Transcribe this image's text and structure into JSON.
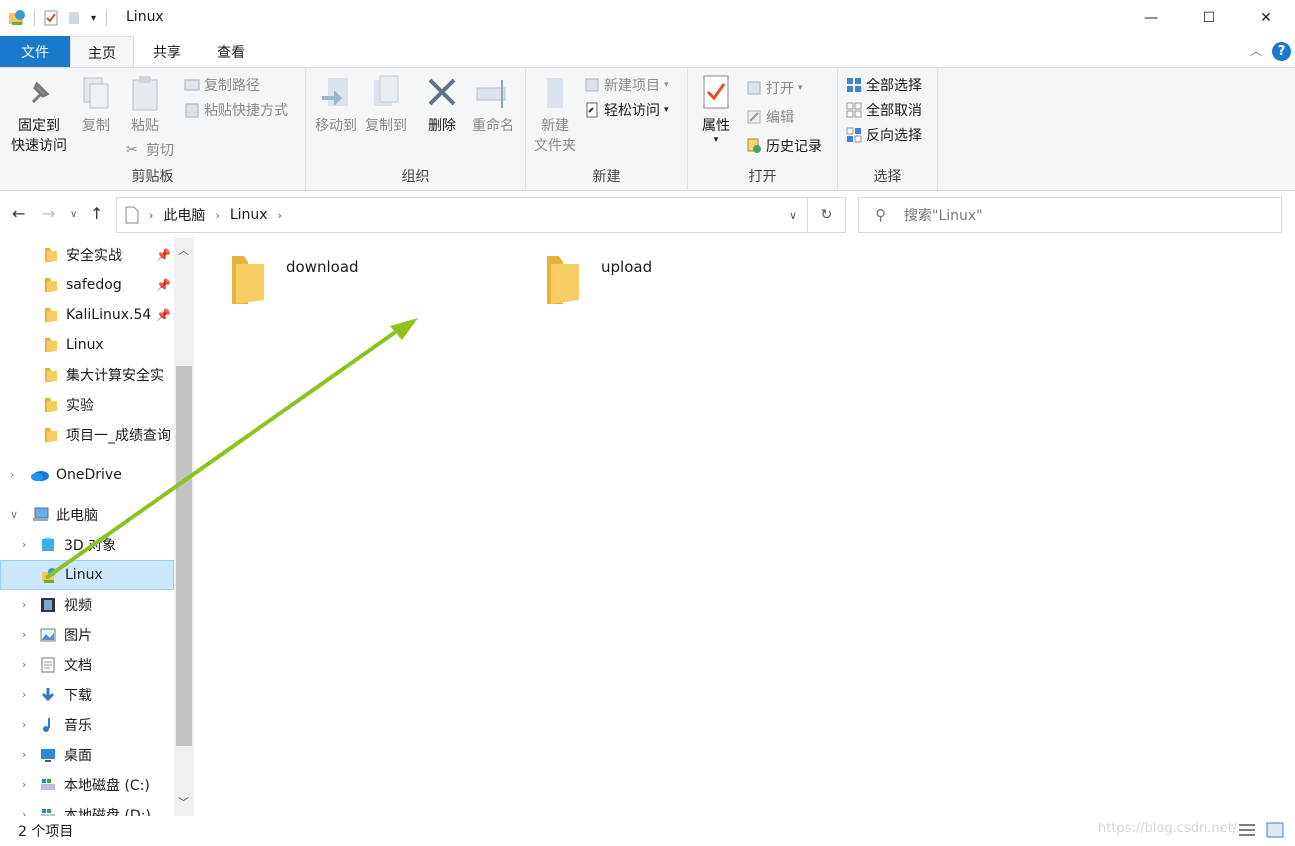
{
  "window": {
    "title": "Linux",
    "minimize_glyph": "—",
    "maximize_glyph": "☐",
    "close_glyph": "✕"
  },
  "tabs": [
    {
      "label": "文件"
    },
    {
      "label": "主页"
    },
    {
      "label": "共享"
    },
    {
      "label": "查看"
    }
  ],
  "ribbon": {
    "clipboard": {
      "label": "剪贴板",
      "pin_line1": "固定到",
      "pin_line2": "快速访问",
      "copy": "复制",
      "paste": "粘贴",
      "copy_path": "复制路径",
      "paste_shortcut": "粘贴快捷方式",
      "cut": "剪切"
    },
    "organize": {
      "label": "组织",
      "move_to": "移动到",
      "copy_to": "复制到",
      "delete": "删除",
      "rename": "重命名"
    },
    "new": {
      "label": "新建",
      "new_folder_line1": "新建",
      "new_folder_line2": "文件夹",
      "new_item": "新建项目",
      "easy_access": "轻松访问"
    },
    "open": {
      "label": "打开",
      "properties": "属性",
      "open": "打开",
      "edit": "编辑",
      "history": "历史记录"
    },
    "select": {
      "label": "选择",
      "select_all": "全部选择",
      "select_none": "全部取消",
      "invert": "反向选择"
    }
  },
  "address": {
    "crumbs": [
      "此电脑",
      "Linux"
    ],
    "search_placeholder": "搜索\"Linux\""
  },
  "nav": {
    "quick_access": [
      {
        "label": "安全实战",
        "pinned": true
      },
      {
        "label": "safedog",
        "pinned": true
      },
      {
        "label": "KaliLinux.54",
        "pinned": true
      },
      {
        "label": "Linux",
        "pinned": false
      },
      {
        "label": "集大计算安全实",
        "pinned": false
      },
      {
        "label": "实验",
        "pinned": false
      },
      {
        "label": "项目一_成绩查询",
        "pinned": false
      }
    ],
    "onedrive": "OneDrive",
    "this_pc": "此电脑",
    "pc_items": [
      {
        "label": "3D 对象",
        "icon": "3d-objects-icon"
      },
      {
        "label": "Linux",
        "icon": "network-drive-icon",
        "selected": true
      },
      {
        "label": "视频",
        "icon": "video-icon"
      },
      {
        "label": "图片",
        "icon": "pictures-icon"
      },
      {
        "label": "文档",
        "icon": "documents-icon"
      },
      {
        "label": "下载",
        "icon": "download-icon"
      },
      {
        "label": "音乐",
        "icon": "music-icon"
      },
      {
        "label": "桌面",
        "icon": "desktop-icon"
      },
      {
        "label": "本地磁盘 (C:)",
        "icon": "local-disk-icon"
      },
      {
        "label": "本地磁盘 (D:)",
        "icon": "local-disk-icon"
      }
    ]
  },
  "files": [
    {
      "name": "download"
    },
    {
      "name": "upload"
    }
  ],
  "status": {
    "count": "2 个项目",
    "watermark": "https://blog.csdn.net/"
  },
  "colors": {
    "file_tab": "#1979ca",
    "selection": "#cce8ff",
    "arrow": "#8dc21f",
    "folder": "#f3c65a"
  }
}
